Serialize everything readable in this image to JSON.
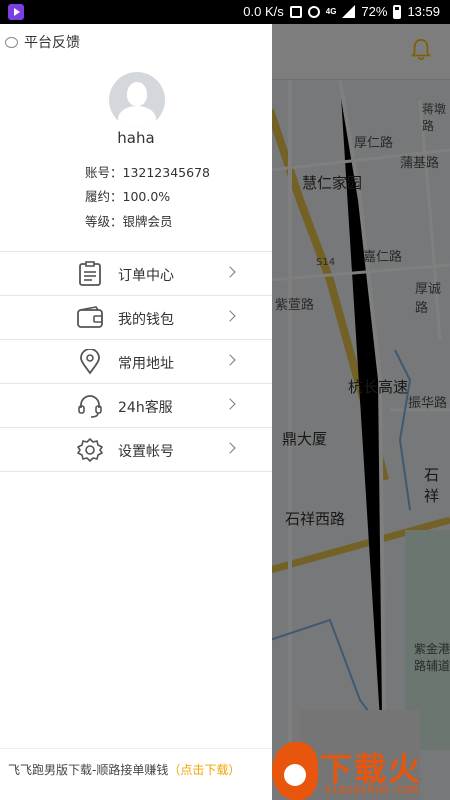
{
  "status_bar": {
    "speed": "0.0 K/s",
    "network": "4G",
    "battery": "72%",
    "time": "13:59"
  },
  "drawer": {
    "feedback_label": "平台反馈",
    "username": "haha",
    "account": "账号：13212345678",
    "fulfill": "履约：100.0%",
    "level": "等级：银牌会员",
    "menu": [
      {
        "label": "订单中心",
        "icon": "clipboard-icon"
      },
      {
        "label": "我的钱包",
        "icon": "wallet-icon"
      },
      {
        "label": "常用地址",
        "icon": "location-pin-icon"
      },
      {
        "label": "24h客服",
        "icon": "headset-icon"
      },
      {
        "label": "设置帐号",
        "icon": "gear-icon"
      }
    ],
    "footer_text": "飞飞跑男版下载-顺路接单赚钱",
    "footer_link": "（点击下载）"
  },
  "map": {
    "labels": {
      "l1": "厚仁路",
      "l2": "慧仁家园",
      "l3": "蒲基路",
      "l4": "嘉仁路",
      "l5": "S14",
      "l6": "紫萱路",
      "l7": "厚诚路",
      "l8": "杭长高速",
      "l9": "振华路",
      "l10": "鼎大厦",
      "l11": "石祥西路",
      "l12": "石祥",
      "l13": "紫金港路辅道",
      "l14": "蒋墩路"
    },
    "accent_color": "#f5c518"
  },
  "watermark": {
    "text": "下载火",
    "sub": "xiazaihuo.com"
  }
}
